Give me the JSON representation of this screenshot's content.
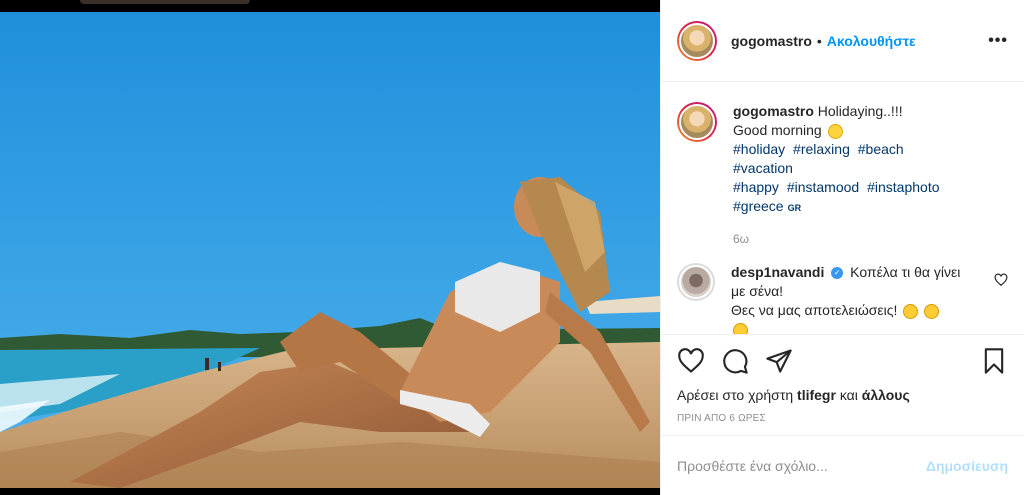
{
  "post": {
    "username": "gogomastro",
    "follow_label": "Ακολουθήστε",
    "caption_line1": "Holidaying..!!!",
    "caption_line2": "Good morning",
    "hashtags": [
      "#holiday",
      "#relaxing",
      "#beach",
      "#vacation",
      "#happy",
      "#instamood",
      "#instaphoto",
      "#greece"
    ],
    "hashtag_suffix": "GR",
    "caption_time": "6ω"
  },
  "comment": {
    "username": "desp1navandi",
    "text_line1": "Κοπέλα τι θα γίνει με σένα!",
    "text_line2": "Θες να μας αποτελειώσεις!"
  },
  "likes": {
    "prefix": "Αρέσει στο χρήστη",
    "user": "tlifegr",
    "conjunction": "και",
    "others": "άλλους"
  },
  "time_ago": "ΠΡΙΝ ΑΠΟ 6 ΩΡΕΣ",
  "add_comment": {
    "placeholder": "Προσθέστε ένα σχόλιο...",
    "publish_label": "Δημοσίευση"
  },
  "colors": {
    "link_blue": "#0095f6",
    "hashtag_blue": "#00376b",
    "muted_gray": "#8e8e8e",
    "publish_disabled": "#b2dffc"
  }
}
